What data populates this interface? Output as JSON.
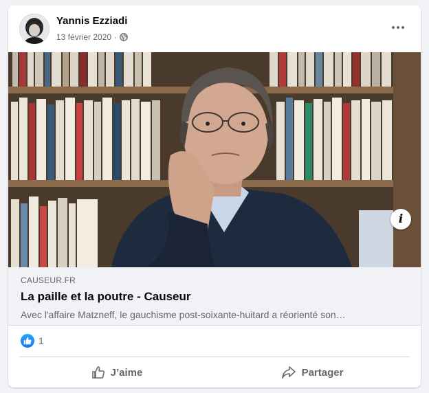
{
  "post": {
    "author": "Yannis Ezziadi",
    "date": "13 février 2020",
    "separator": "·",
    "privacy_icon": "globe-icon",
    "more_icon": "more-options-icon"
  },
  "link": {
    "domain": "CAUSEUR.FR",
    "title": "La paille et la poutre - Causeur",
    "description": "Avec l'affaire Matzneff, le gauchisme post-soixante-huitard a réorienté son…",
    "info_icon": "info-icon",
    "info_label": "i"
  },
  "reactions": {
    "icon": "like-reaction-icon",
    "count": "1"
  },
  "actions": {
    "like_label": "J’aime",
    "share_label": "Partager"
  },
  "colors": {
    "background": "#f0f2f5",
    "card": "#ffffff",
    "secondary_text": "#65676b",
    "like_blue": "#1877f2"
  }
}
